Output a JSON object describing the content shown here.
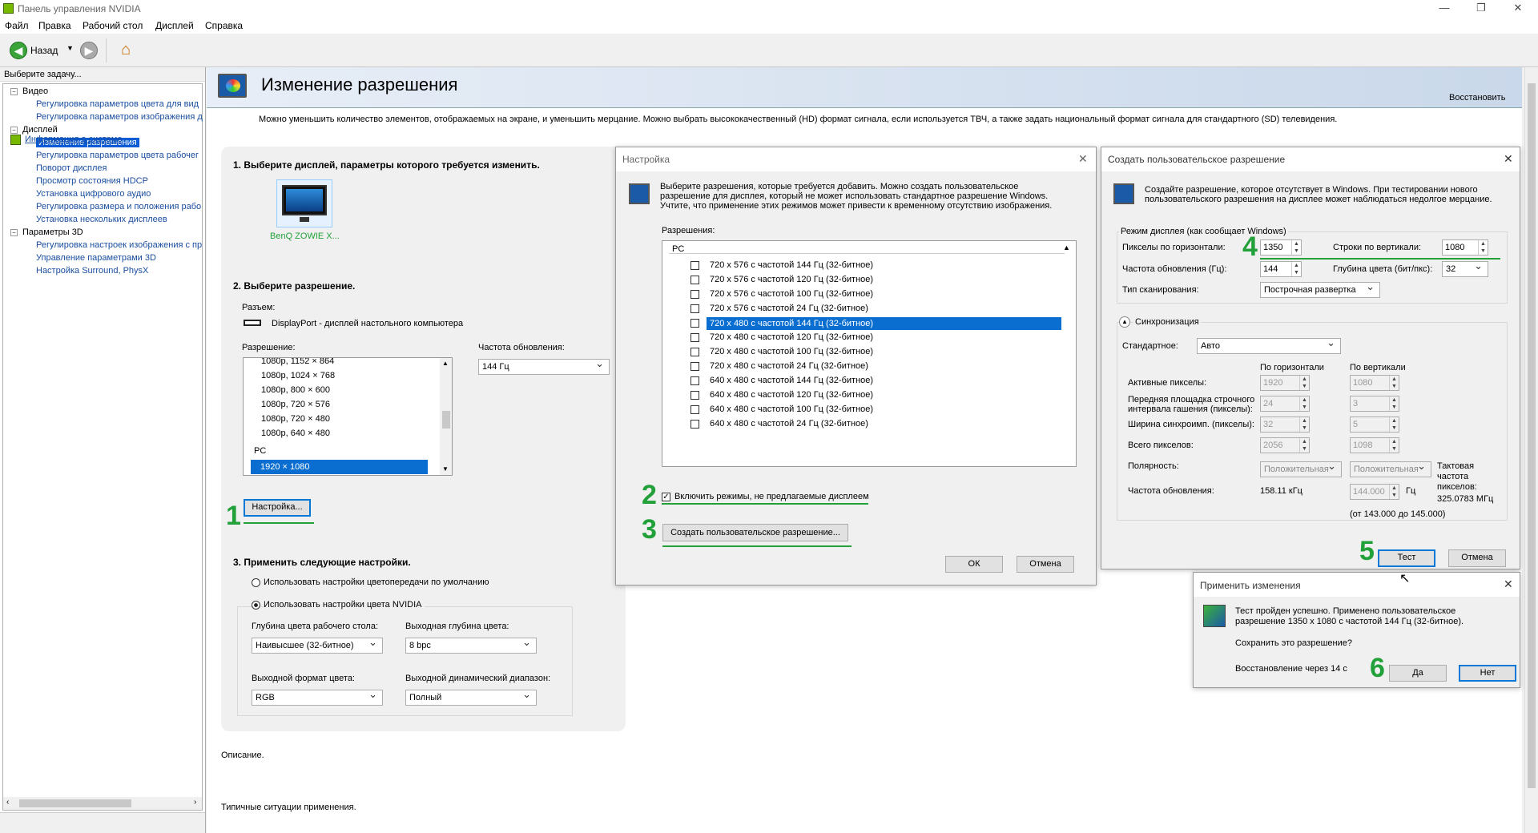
{
  "window": {
    "title": "Панель управления NVIDIA",
    "controls": [
      "—",
      "❐",
      "✕"
    ]
  },
  "menu": [
    "Файл",
    "Правка",
    "Рабочий стол",
    "Дисплей",
    "Справка"
  ],
  "toolbar": {
    "back_label": "Назад"
  },
  "left_pane": {
    "header": "Выберите задачу...",
    "tree": [
      {
        "label": "Видео",
        "level": 0,
        "toggle": "−"
      },
      {
        "label": "Регулировка параметров цвета для вид",
        "level": 1
      },
      {
        "label": "Регулировка параметров изображения д",
        "level": 1
      },
      {
        "label": "Дисплей",
        "level": 0,
        "toggle": "−"
      },
      {
        "label": "Изменение разрешения",
        "level": 1,
        "selected": true
      },
      {
        "label": "Регулировка параметров цвета рабочег",
        "level": 1
      },
      {
        "label": "Поворот дисплея",
        "level": 1
      },
      {
        "label": "Просмотр состояния HDCP",
        "level": 1
      },
      {
        "label": "Установка цифрового аудио",
        "level": 1
      },
      {
        "label": "Регулировка размера и положения рабо",
        "level": 1
      },
      {
        "label": "Установка нескольких дисплеев",
        "level": 1
      },
      {
        "label": "Параметры 3D",
        "level": 0,
        "toggle": "−"
      },
      {
        "label": "Регулировка настроек изображения с пр",
        "level": 1
      },
      {
        "label": "Управление параметрами 3D",
        "level": 1
      },
      {
        "label": "Настройка Surround, PhysX",
        "level": 1
      }
    ],
    "sysinfo_link": "Информация о системе"
  },
  "main": {
    "title": "Изменение разрешения",
    "restore_link": "Восстановить",
    "description": "Можно уменьшить количество элементов, отображаемых на экране, и уменьшить мерцание. Можно выбрать высококачественный (HD) формат сигнала, если используется ТВЧ, а также задать национальный формат сигнала для стандартного (SD) телевидения.",
    "step1": "1. Выберите дисплей, параметры которого требуется изменить.",
    "monitor_label": "BenQ ZOWIE X...",
    "step2": "2. Выберите разрешение.",
    "connector_label": "Разъем:",
    "connector_value": "DisplayPort - дисплей настольного компьютера",
    "resolution_label": "Разрешение:",
    "resolution_items": [
      "1080p, 1152 × 864",
      "1080p, 1024 × 768",
      "1080p, 800 × 600",
      "1080p, 720 × 576",
      "1080p, 720 × 480",
      "1080p, 640 × 480"
    ],
    "resolution_group": "PC",
    "resolution_selected": "1920 × 1080",
    "refresh_label": "Частота обновления:",
    "refresh_value": "144 Гц",
    "customize_button": "Настройка...",
    "step3": "3. Применить следующие настройки.",
    "radio_default": "Использовать настройки цветопередачи по умолчанию",
    "radio_nvidia": "Использовать настройки цвета NVIDIA",
    "desktop_depth_label": "Глубина цвета рабочего стола:",
    "desktop_depth_value": "Наивысшее (32-битное)",
    "output_depth_label": "Выходная глубина цвета:",
    "output_depth_value": "8 bpc",
    "output_format_label": "Выходной формат цвета:",
    "output_format_value": "RGB",
    "dynamic_range_label": "Выходной динамический диапазон:",
    "dynamic_range_value": "Полный",
    "desc_label": "Описание.",
    "typical_label": "Типичные ситуации применения."
  },
  "setup_dialog": {
    "title": "Настройка",
    "info": "Выберите разрешения, которые требуется добавить. Можно создать пользовательское разрешение для дисплея, который не может использовать стандартное разрешение Windows. Учтите, что применение этих режимов может привести к временному отсутствию изображения.",
    "list_label": "Разрешения:",
    "group": "PC",
    "modes": [
      "720 x 576 с частотой 144 Гц (32-битное)",
      "720 x 576 с частотой 120 Гц (32-битное)",
      "720 x 576 с частотой 100 Гц (32-битное)",
      "720 x 576 с частотой 24 Гц (32-битное)",
      "720 x 480 с частотой 144 Гц (32-битное)",
      "720 x 480 с частотой 120 Гц (32-битное)",
      "720 x 480 с частотой 100 Гц (32-битное)",
      "720 x 480 с частотой 24 Гц (32-битное)",
      "640 x 480 с частотой 144 Гц (32-битное)",
      "640 x 480 с частотой 120 Гц (32-битное)",
      "640 x 480 с частотой 100 Гц (32-битное)",
      "640 x 480 с частотой 24 Гц (32-битное)"
    ],
    "enable_label": "Включить режимы, не предлагаемые дисплеем",
    "create_button": "Создать пользовательское разрешение...",
    "ok": "ОК",
    "cancel": "Отмена"
  },
  "custom_dialog": {
    "title": "Создать пользовательское разрешение",
    "info": "Создайте разрешение, которое отсутствует в Windows. При тестировании нового пользовательского разрешения на дисплее может наблюдаться недолгое мерцание.",
    "group_label": "Режим дисплея (как сообщает Windows)",
    "h_pixels_label": "Пикселы по горизонтали:",
    "h_pixels": "1350",
    "v_lines_label": "Строки по вертикали:",
    "v_lines": "1080",
    "refresh_label": "Частота обновления (Гц):",
    "refresh": "144",
    "depth_label": "Глубина цвета (бит/пкс):",
    "depth": "32",
    "scan_label": "Тип сканирования:",
    "scan": "Построчная развертка",
    "sync_label": "Синхронизация",
    "standard_label": "Стандартное:",
    "standard": "Авто",
    "col_h": "По горизонтали",
    "col_v": "По вертикали",
    "active_label": "Активные пикселы:",
    "active_h": "1920",
    "active_v": "1080",
    "porch_label": "Передняя площадка строчного интервала гашения (пикселы):",
    "porch_h": "24",
    "porch_v": "3",
    "sync_width_label": "Ширина синхроимп. (пикселы):",
    "sync_h": "32",
    "sync_v": "5",
    "total_label": "Всего пикселов:",
    "total_h": "2056",
    "total_v": "1098",
    "polarity_label": "Полярность:",
    "pol_h": "Положительная",
    "pol_v": "Положительная",
    "pixclock_label": "Тактовая частота пикселов:",
    "pixclock_value": "325.0783 МГц",
    "refresh2_label": "Частота обновления:",
    "refresh_h": "158.11 кГц",
    "refresh_v": "144.000",
    "hz": "Гц",
    "range": "(от 143.000 до 145.000)",
    "test": "Тест",
    "cancel": "Отмена"
  },
  "apply_dialog": {
    "title": "Применить изменения",
    "message": "Тест пройден успешно. Применено пользовательское разрешение 1350 x 1080 с частотой 144 Гц (32-битное).",
    "question": "Сохранить это разрешение?",
    "countdown": "Восстановление через 14 с",
    "yes": "Да",
    "no": "Нет"
  },
  "annotations": [
    "1",
    "2",
    "3",
    "4",
    "5",
    "6"
  ],
  "colors": {
    "annotation": "#22a13a",
    "selection": "#0a6ed1",
    "link": "#1a4ea0"
  }
}
